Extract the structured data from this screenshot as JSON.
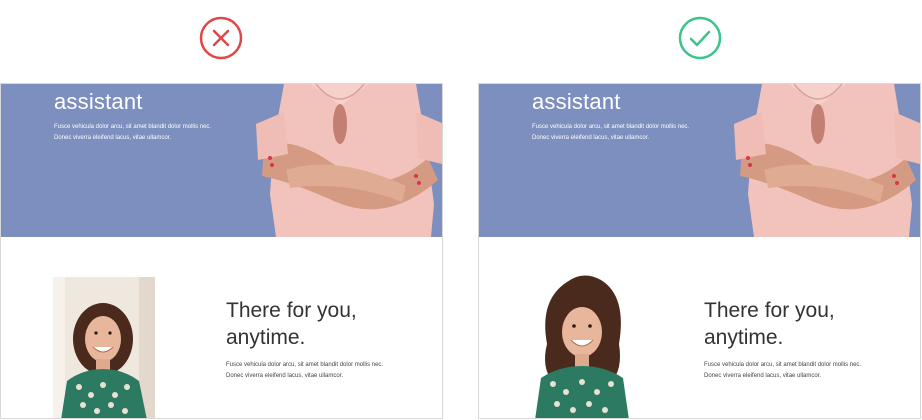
{
  "comparison": {
    "left": {
      "verdict_icon": "x-circle-icon",
      "verdict_color": "#e04848",
      "hero": {
        "title": "assistant",
        "body_lines": [
          "Fusce vehicula dolor arcu, sit amet blandit dolor mollis nec.",
          "Donec viverra eleifend lacus, vitae ullamcor."
        ]
      },
      "section": {
        "title_lines": [
          "There for you,",
          "anytime."
        ],
        "body_lines": [
          "Fusce vehicula dolor arcu, sit amet blandit dolor mollis nec.",
          "Donec viverra eleifend lacus, vitae ullamcor."
        ]
      },
      "photo_style": "boxed-background"
    },
    "right": {
      "verdict_icon": "check-circle-icon",
      "verdict_color": "#3cc48a",
      "hero": {
        "title": "assistant",
        "body_lines": [
          "Fusce vehicula dolor arcu, sit amet blandit dolor mollis nec.",
          "Donec viverra eleifend lacus, vitae ullamcor."
        ]
      },
      "section": {
        "title_lines": [
          "There for you,",
          "anytime."
        ],
        "body_lines": [
          "Fusce vehicula dolor arcu, sit amet blandit dolor mollis nec.",
          "Donec viverra eleifend lacus, vitae ullamcor."
        ]
      },
      "photo_style": "cutout-no-background"
    }
  },
  "colors": {
    "hero_bg": "#7d8fbf",
    "text_dark": "#333333",
    "panel_border": "#d8d8d8"
  }
}
